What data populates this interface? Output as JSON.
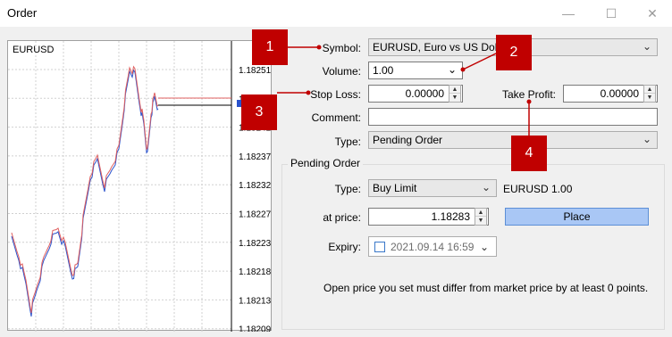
{
  "window": {
    "title": "Order",
    "minimize": "—",
    "maximize": "☐",
    "close": "✕"
  },
  "chart": {
    "symbol": "EURUSD",
    "price_labels": [
      "1.18251",
      "1.18246",
      "1.18242",
      "1.18237",
      "1.18232",
      "1.18227",
      "1.18223",
      "1.18218",
      "1.18213",
      "1.18209"
    ],
    "colors": {
      "bid": "#e06060",
      "ask": "#2952cc",
      "tag": "#2952cc"
    }
  },
  "form": {
    "symbol_label": "Symbol:",
    "symbol_value": "EURUSD, Euro vs US Dollar",
    "volume_label": "Volume:",
    "volume_value": "1.00",
    "stop_loss_label": "Stop Loss:",
    "stop_loss_value": "0.00000",
    "take_profit_label": "Take Profit:",
    "take_profit_value": "0.00000",
    "comment_label": "Comment:",
    "comment_value": "",
    "type_label": "Type:",
    "type_value": "Pending Order"
  },
  "pending": {
    "group_title": "Pending Order",
    "type_label": "Type:",
    "type_value": "Buy Limit",
    "symbol_volume": "EURUSD 1.00",
    "price_label": "at price:",
    "price_value": "1.18283",
    "place_button": "Place",
    "expiry_label": "Expiry:",
    "expiry_value": "2021.09.14 16:59",
    "info": "Open price you set must differ from market price by at least 0 points."
  },
  "callouts": [
    "1",
    "2",
    "3",
    "4"
  ],
  "accent_color": "#c00000"
}
